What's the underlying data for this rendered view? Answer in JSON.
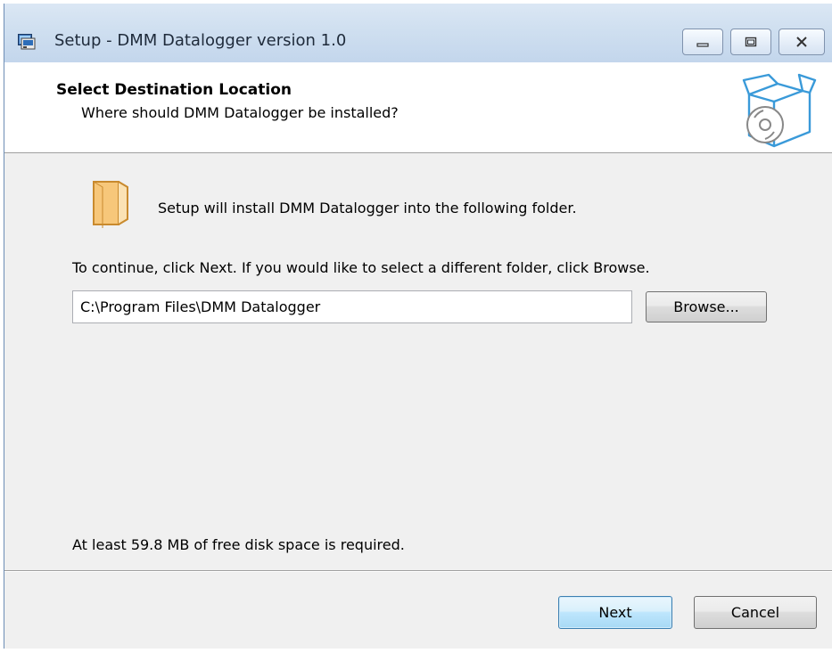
{
  "window": {
    "title": "Setup - DMM Datalogger version 1.0",
    "icons": {
      "app": "setup-app-icon",
      "minimize": "minimize-icon",
      "maximize": "maximize-icon",
      "close": "close-icon"
    }
  },
  "header": {
    "title": "Select Destination Location",
    "subtitle": "Where should DMM Datalogger be installed?",
    "icon": "install-box-icon"
  },
  "body": {
    "folder_icon": "folder-icon",
    "intro": "Setup will install DMM Datalogger into the following folder.",
    "instruction": "To continue, click Next. If you would like to select a different folder, click Browse.",
    "path_value": "C:\\Program Files\\DMM Datalogger",
    "browse_label": "Browse...",
    "disk_space": "At least 59.8 MB of free disk space is required."
  },
  "footer": {
    "next_label": "Next",
    "cancel_label": "Cancel"
  },
  "colors": {
    "titlebar": "#cfdff0",
    "panel": "#f0f0f0",
    "header_bg": "#ffffff",
    "default_button_border": "#3c7fb1"
  }
}
